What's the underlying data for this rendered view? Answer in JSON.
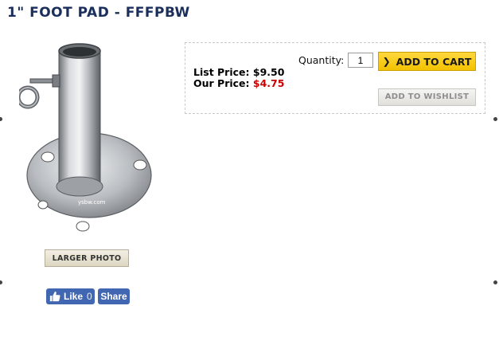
{
  "product": {
    "title": "1\" FOOT PAD - FFFPBW",
    "image_watermark": "ysbw.com",
    "larger_photo_label": "LARGER PHOTO"
  },
  "social": {
    "like_label": "Like",
    "like_count": "0",
    "share_label": "Share",
    "brand_color": "#4267b2"
  },
  "pricing": {
    "list_price_label": "List Price:",
    "list_price_value": "$9.50",
    "our_price_label": "Our Price:",
    "our_price_value": "$4.75",
    "sale_color": "#cc0000"
  },
  "purchase": {
    "quantity_label": "Quantity:",
    "quantity_value": "1",
    "add_to_cart_label": "ADD TO CART",
    "add_to_wishlist_label": "ADD TO WISHLIST"
  },
  "icons": {
    "add_to_cart": "chevron-right-icon",
    "like": "thumbs-up-icon"
  }
}
